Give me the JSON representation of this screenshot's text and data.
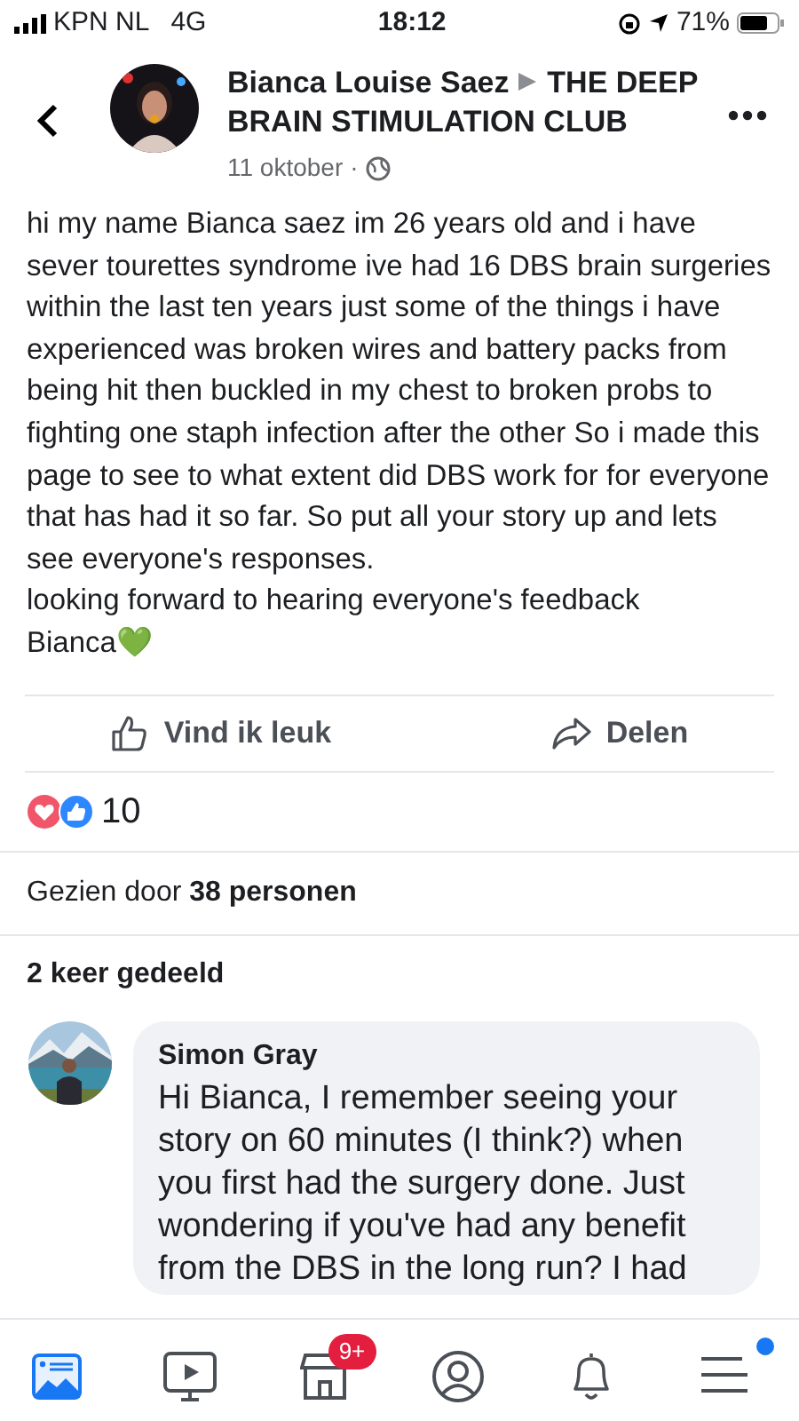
{
  "status_bar": {
    "carrier": "KPN NL",
    "network": "4G",
    "time": "18:12",
    "battery": "71%"
  },
  "post": {
    "author": "Bianca Louise Saez",
    "group": "THE DEEP BRAIN STIMULATION CLUB",
    "date": "11 oktober",
    "separator": "·",
    "paragraphs": [
      "hi my name Bianca saez im 26 years old and i have sever tourettes syndrome ive had 16 DBS brain surgeries within the last ten years just some of the things i have  experienced was broken wires and battery packs from being hit then buckled in my chest to broken probs to fighting one staph infection after the other So i made this page to see to what extent did DBS work for for everyone that has had it so far. So put all your story up and lets see everyone's responses.",
      "looking forward to hearing everyone's feedback",
      "Bianca💚"
    ]
  },
  "actions": [
    {
      "kind": "like",
      "label": "Vind ik leuk"
    },
    {
      "kind": "share",
      "label": "Delen"
    }
  ],
  "reactions": {
    "count": "10"
  },
  "seen": "Gezien door **38 personen**",
  "shares": "2 keer gedeeld",
  "comment": {
    "author": "Simon Gray",
    "text": "Hi Bianca, I remember seeing your story on 60 minutes (I think?) when you first had the surgery done. Just wondering if you've had any benefit from the DBS in the long run? I had"
  },
  "tab_bar": [
    {
      "kind": "feed",
      "selected": true
    },
    {
      "kind": "video",
      "selected": false
    },
    {
      "kind": "marketplace",
      "selected": false,
      "badge": "9+"
    },
    {
      "kind": "profile",
      "selected": false
    },
    {
      "kind": "notifications",
      "selected": false
    },
    {
      "kind": "menu",
      "selected": false,
      "dot": true
    }
  ]
}
